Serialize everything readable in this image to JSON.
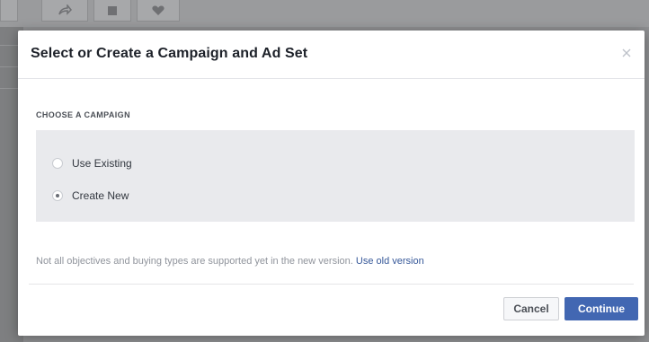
{
  "modal": {
    "title": "Select or Create a Campaign and Ad Set",
    "close_icon": "close-icon"
  },
  "campaign": {
    "section_label": "CHOOSE A CAMPAIGN",
    "options": [
      {
        "label": "Use Existing",
        "selected": false
      },
      {
        "label": "Create New",
        "selected": true
      }
    ]
  },
  "notice": {
    "text": "Not all objectives and buying types are supported yet in the new version.",
    "link_label": "Use old version"
  },
  "footer": {
    "cancel_label": "Cancel",
    "continue_label": "Continue"
  },
  "colors": {
    "primary": "#4267b2",
    "link": "#365899",
    "panel": "#e9eaed"
  }
}
